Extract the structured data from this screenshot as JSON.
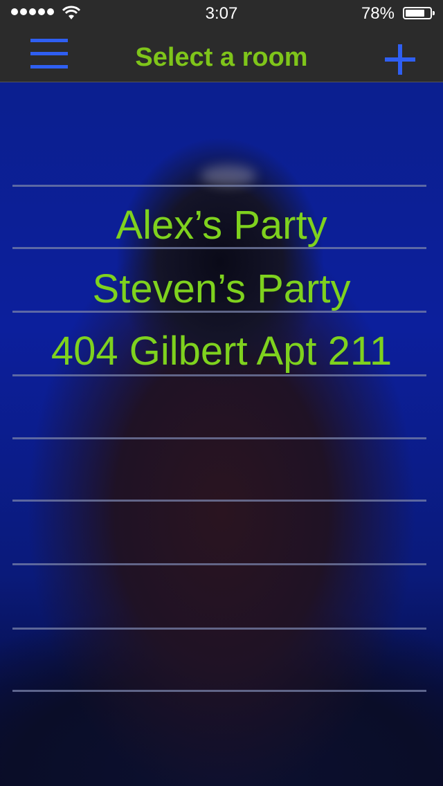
{
  "status_bar": {
    "time": "3:07",
    "battery_percent": "78%",
    "battery_level": 0.78,
    "signal_dots": 5
  },
  "nav": {
    "title": "Select a room",
    "menu_icon": "hamburger-menu-icon",
    "add_icon": "plus-icon"
  },
  "rooms": [
    "Alex’s Party",
    "Steven’s Party",
    "404 Gilbert Apt 211"
  ],
  "colors": {
    "accent_green": "#7fd21e",
    "accent_blue": "#2f5ff2",
    "bar_bg": "#2b2b2b"
  }
}
